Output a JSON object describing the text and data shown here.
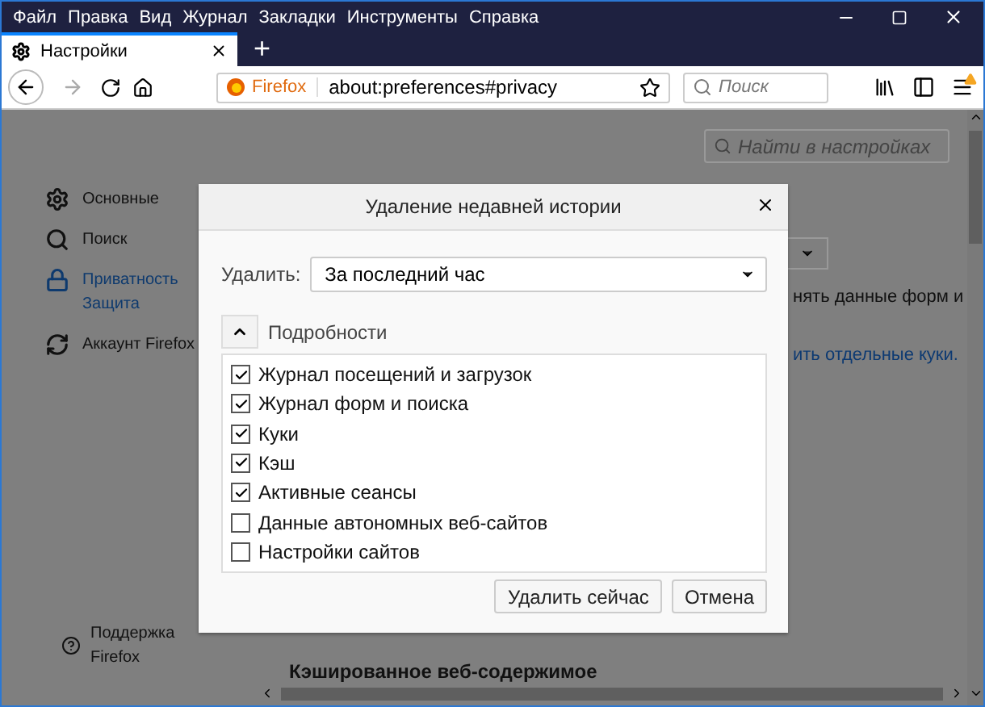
{
  "menu_bar": [
    "Файл",
    "Правка",
    "Вид",
    "Журнал",
    "Закладки",
    "Инструменты",
    "Справка"
  ],
  "tabs": [
    {
      "label": "Настройки",
      "selected": true
    }
  ],
  "new_tab": "+",
  "address_bar": {
    "identity": "Firefox",
    "url": "about:preferences#privacy"
  },
  "search": {
    "placeholder": "Поиск"
  },
  "page": {
    "search": {
      "placeholder": "Найти в настройках"
    },
    "sidebar": [
      {
        "kind": "general",
        "label": "Основные",
        "selected": false
      },
      {
        "kind": "search",
        "label": "Поиск",
        "selected": false
      },
      {
        "kind": "privacy",
        "label": "Приватность\nЗащита",
        "selected": true
      },
      {
        "kind": "sync",
        "label": "Аккаунт Firefox",
        "selected": false
      }
    ],
    "support": "Поддержка\nFirefox",
    "fragments": [
      {
        "kind": "text",
        "text": "нять данные форм и"
      },
      {
        "kind": "link",
        "text": "ить отдельные куки."
      }
    ],
    "heading": "Кэшированное веб-содержимое"
  },
  "dialog": {
    "title": "Удаление недавней истории",
    "range_label": "Удалить:",
    "range_value": "За последний час",
    "details": {
      "label": "Подробности",
      "expanded": true
    },
    "items": [
      {
        "label": "Журнал посещений и загрузок",
        "checked": true
      },
      {
        "label": "Журнал форм и поиска",
        "checked": true
      },
      {
        "label": "Куки",
        "checked": true
      },
      {
        "label": "Кэш",
        "checked": true
      },
      {
        "label": "Активные сеансы",
        "checked": true
      },
      {
        "label": "Данные автономных веб-сайтов",
        "checked": false
      },
      {
        "label": "Настройки сайтов",
        "checked": false
      }
    ],
    "buttons": [
      "Удалить сейчас",
      "Отмена"
    ]
  }
}
